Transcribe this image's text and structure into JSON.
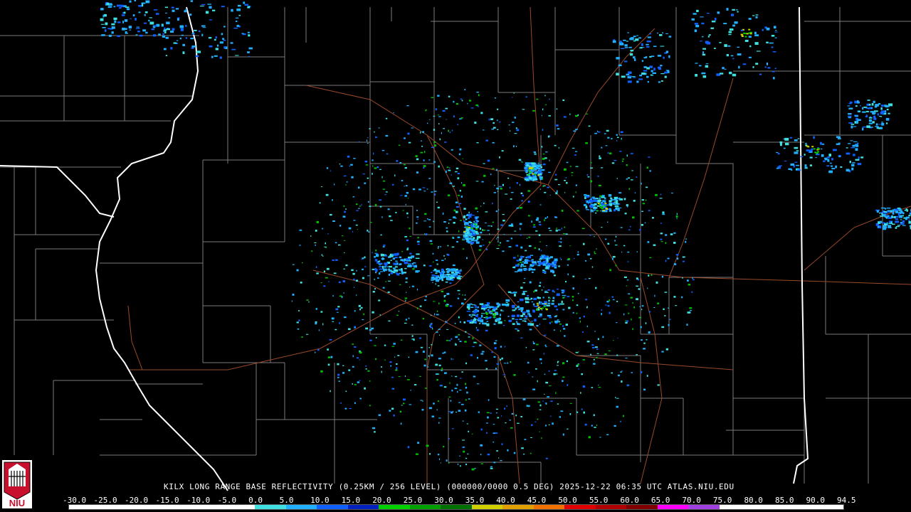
{
  "product": {
    "caption": "KILX LONG RANGE BASE REFLECTIVITY (0.25KM / 256 LEVEL) (000000/0000 0.5 DEG) 2025-12-22 06:35 UTC  ATLAS.NIU.EDU"
  },
  "logo": {
    "text": "NIU",
    "icon": "university-seal-icon"
  },
  "color_scale": {
    "labels": [
      "-30.0",
      "-25.0",
      "-20.0",
      "-15.0",
      "-10.0",
      "-5.0",
      "0.0",
      "5.0",
      "10.0",
      "15.0",
      "20.0",
      "25.0",
      "30.0",
      "35.0",
      "40.0",
      "45.0",
      "50.0",
      "55.0",
      "60.0",
      "65.0",
      "70.0",
      "75.0",
      "80.0",
      "85.0",
      "90.0",
      "94.5"
    ],
    "colors": [
      "#ffffff",
      "#ffffff",
      "#ffffff",
      "#ffffff",
      "#ffffff",
      "#ffffff",
      "#40e0e0",
      "#20b0ff",
      "#1060ff",
      "#0020c0",
      "#00d000",
      "#00a000",
      "#007000",
      "#d0d000",
      "#e0a000",
      "#f07000",
      "#e00000",
      "#b00000",
      "#800000",
      "#ff00ff",
      "#a040e0",
      "#ffffff",
      "#ffffff",
      "#ffffff",
      "#ffffff"
    ]
  },
  "colors": {
    "background": "#000000",
    "county_lines": "#7a7a7a",
    "state_lines": "#ffffff",
    "highways": "#9a4a2a"
  }
}
